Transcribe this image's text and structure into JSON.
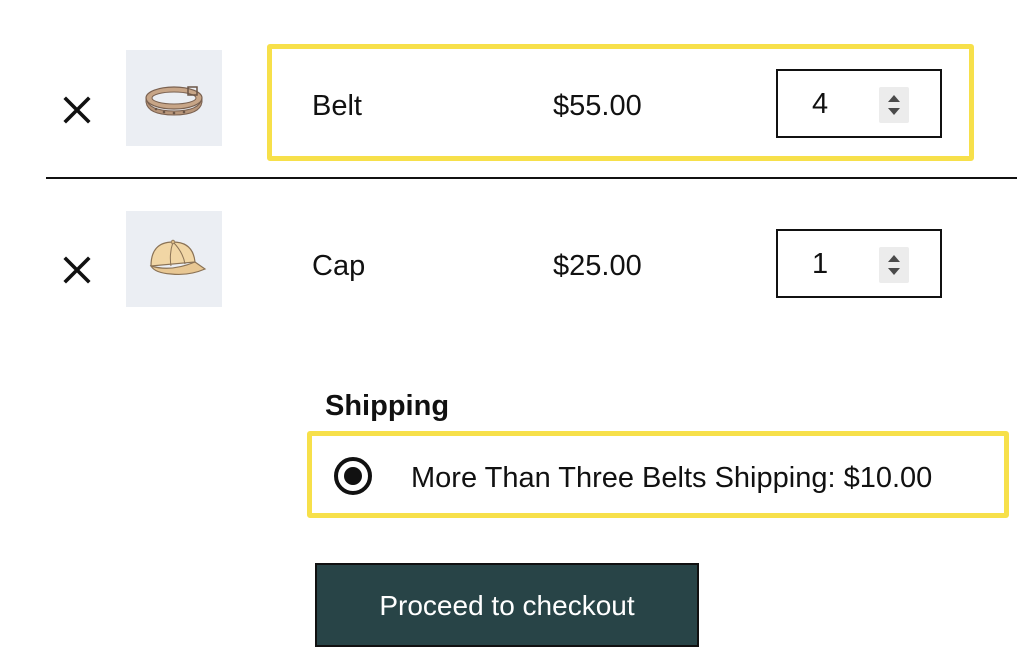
{
  "cart": {
    "items": [
      {
        "remove_icon": "close-icon",
        "thumbnail_icon": "belt-thumbnail-icon",
        "name": "Belt",
        "price": "$55.00",
        "quantity": "4"
      },
      {
        "remove_icon": "close-icon",
        "thumbnail_icon": "cap-thumbnail-icon",
        "name": "Cap",
        "price": "$25.00",
        "quantity": "1"
      }
    ]
  },
  "shipping": {
    "title": "Shipping",
    "option_label": "More Than Three Belts Shipping: $10.00",
    "option_selected": true
  },
  "checkout": {
    "button_label": "Proceed to checkout"
  },
  "colors": {
    "highlight": "#f7e04a",
    "button_bg": "#284447",
    "thumbnail_bg": "#ebeef3"
  }
}
